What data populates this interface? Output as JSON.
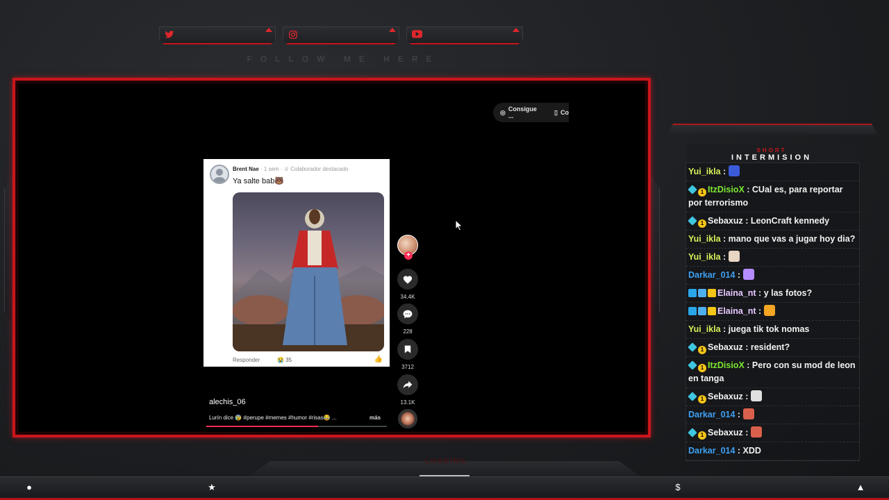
{
  "social": {
    "follow_text": "FOLLOW ME HERE",
    "items": [
      {
        "name": "twitter-icon",
        "glyph": "🐦"
      },
      {
        "name": "instagram-icon",
        "glyph": "◎"
      },
      {
        "name": "youtube-icon",
        "glyph": "▶"
      }
    ]
  },
  "video": {
    "pill_label": "Consigue ...",
    "pill_label_2": "Co",
    "post": {
      "author": "Brent Nae",
      "time": "· 1 sem ·",
      "tag": "Colaborador destacado",
      "text": "Ya salte bab🐻",
      "reply": "Responder",
      "reactions": "😭 35"
    },
    "actions": {
      "likes": "34.4K",
      "comments": "228",
      "saves": "3712",
      "shares": "13.1K"
    },
    "username": "alechis_06",
    "caption": "Lurín dice 😰 #perupe #memes #humor #risas😂 ...",
    "caption_more": "más",
    "progress": 0.62
  },
  "chat": {
    "header_small": "SHORT",
    "header_big": "INTERMISION",
    "messages": [
      {
        "user": "Yui_ikla",
        "color": "#d6f15a",
        "badges": [],
        "text": "",
        "emote": "e-blue"
      },
      {
        "user": "ItzDisioX",
        "color": "#7ce832",
        "badges": [
          "b-gem",
          "b-one"
        ],
        "text": "CUal es, para reportar por terrorismo",
        "emote": ""
      },
      {
        "user": "Sebaxuz",
        "color": "#f2f2f2",
        "badges": [
          "b-gem",
          "b-one"
        ],
        "text": "LeonCraft kennedy",
        "emote": ""
      },
      {
        "user": "Yui_ikla",
        "color": "#d6f15a",
        "badges": [],
        "text": "mano que vas a jugar hoy dia?",
        "emote": ""
      },
      {
        "user": "Yui_ikla",
        "color": "#d6f15a",
        "badges": [],
        "text": "",
        "emote": "e-cat"
      },
      {
        "user": "Darkar_014",
        "color": "#3ea0f2",
        "badges": [],
        "text": "",
        "emote": "e-face"
      },
      {
        "user": "Elaina_nt",
        "color": "#e6c8ff",
        "badges": [
          "b-arrow",
          "b-cube",
          "b-crown"
        ],
        "text": "y las fotos?",
        "emote": ""
      },
      {
        "user": "Elaina_nt",
        "color": "#e6c8ff",
        "badges": [
          "b-arrow",
          "b-cube",
          "b-crown"
        ],
        "text": "",
        "emote": "e-fire"
      },
      {
        "user": "Yui_ikla",
        "color": "#d6f15a",
        "badges": [],
        "text": "juega tik tok nomas",
        "emote": ""
      },
      {
        "user": "Sebaxuz",
        "color": "#f2f2f2",
        "badges": [
          "b-gem",
          "b-one"
        ],
        "text": "resident?",
        "emote": ""
      },
      {
        "user": "ItzDisioX",
        "color": "#7ce832",
        "badges": [
          "b-gem",
          "b-one"
        ],
        "text": "Pero con su mod de leon en tanga",
        "emote": ""
      },
      {
        "user": "Sebaxuz",
        "color": "#f2f2f2",
        "badges": [
          "b-gem",
          "b-one"
        ],
        "text": "",
        "emote": "e-white"
      },
      {
        "user": "Darkar_014",
        "color": "#3ea0f2",
        "badges": [],
        "text": "",
        "emote": "e-red"
      },
      {
        "user": "Sebaxuz",
        "color": "#f2f2f2",
        "badges": [
          "b-gem",
          "b-one"
        ],
        "text": "",
        "emote": "e-red"
      },
      {
        "user": "Darkar_014",
        "color": "#3ea0f2",
        "badges": [],
        "text": "XDD",
        "emote": ""
      }
    ]
  },
  "overlay": {
    "loading_text": "LOADING",
    "bottom_icons": [
      {
        "name": "user-icon",
        "glyph": "●"
      },
      {
        "name": "star-icon",
        "glyph": "★"
      },
      {
        "name": "dollar-icon",
        "glyph": "$"
      },
      {
        "name": "rocket-icon",
        "glyph": "▲"
      }
    ]
  }
}
